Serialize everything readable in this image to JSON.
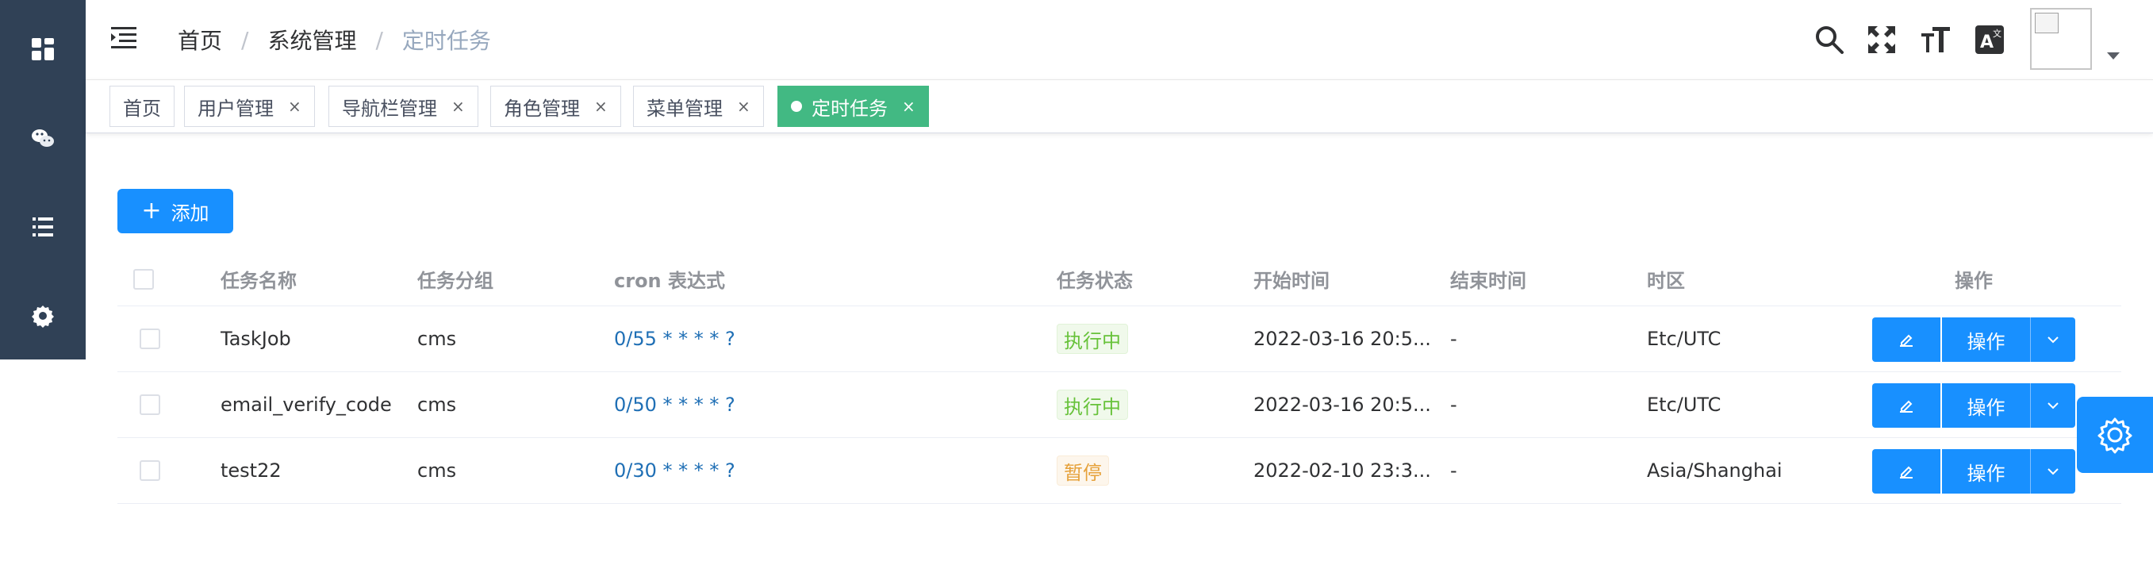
{
  "sidebar": {
    "icons": [
      "dashboard-icon",
      "wechat-icon",
      "list-icon",
      "gear-icon"
    ]
  },
  "breadcrumb": {
    "items": [
      "首页",
      "系统管理",
      "定时任务"
    ],
    "separator": "/"
  },
  "tags": [
    {
      "label": "首页",
      "closable": false,
      "active": false
    },
    {
      "label": "用户管理",
      "closable": true,
      "active": false
    },
    {
      "label": "导航栏管理",
      "closable": true,
      "active": false
    },
    {
      "label": "角色管理",
      "closable": true,
      "active": false
    },
    {
      "label": "菜单管理",
      "closable": true,
      "active": false
    },
    {
      "label": "定时任务",
      "closable": true,
      "active": true
    }
  ],
  "tag_close_glyph": "×",
  "toolbar": {
    "add_label": "添加",
    "add_glyph": "+"
  },
  "table": {
    "headers": {
      "name": "任务名称",
      "group": "任务分组",
      "cron": "cron 表达式",
      "status": "任务状态",
      "start": "开始时间",
      "end": "结束时间",
      "timezone": "时区",
      "actions": "操作"
    },
    "rows": [
      {
        "name": "TaskJob",
        "group": "cms",
        "cron": "0/55 * * * * ?",
        "status": "执行中",
        "status_type": "running",
        "start": "2022-03-16 20:5...",
        "end": "-",
        "timezone": "Etc/UTC",
        "action_label": "操作"
      },
      {
        "name": "email_verify_code",
        "group": "cms",
        "cron": "0/50 * * * * ?",
        "status": "执行中",
        "status_type": "running",
        "start": "2022-03-16 20:5...",
        "end": "-",
        "timezone": "Etc/UTC",
        "action_label": "操作"
      },
      {
        "name": "test22",
        "group": "cms",
        "cron": "0/30 * * * * ?",
        "status": "暂停",
        "status_type": "paused",
        "start": "2022-02-10 23:3...",
        "end": "-",
        "timezone": "Asia/Shanghai",
        "action_label": "操作"
      }
    ]
  },
  "colors": {
    "sidebar_bg": "#304156",
    "primary": "#1890ff",
    "active_tag": "#42b983",
    "status_running": "#67c23a",
    "status_paused": "#e6a23c"
  },
  "header_icons": [
    "hamburger-icon",
    "search-icon",
    "fullscreen-icon",
    "font-size-icon",
    "translate-icon",
    "avatar",
    "caret-down-icon"
  ]
}
